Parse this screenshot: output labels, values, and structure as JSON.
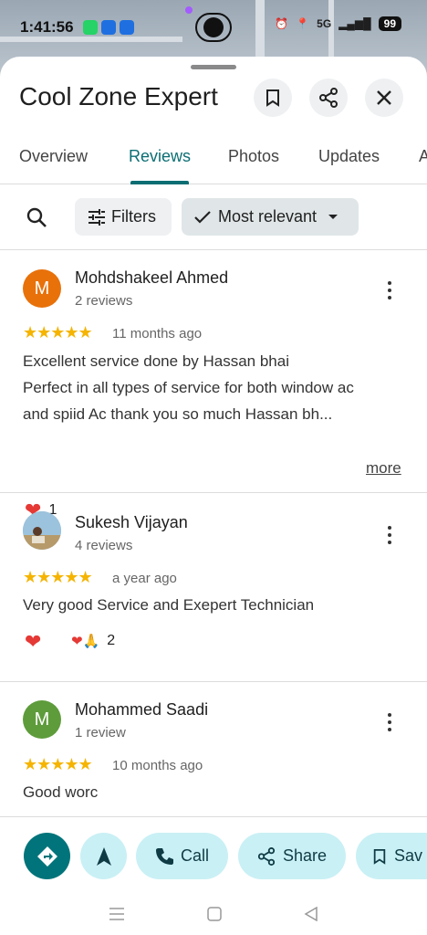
{
  "status": {
    "time": "1:41:56",
    "battery": "99",
    "network": "5G"
  },
  "place": {
    "title": "Cool Zone Expert"
  },
  "header_icons": [
    "bookmark-icon",
    "share-icon",
    "close-icon"
  ],
  "tabs": [
    {
      "label": "Overview"
    },
    {
      "label": "Reviews"
    },
    {
      "label": "Photos"
    },
    {
      "label": "Updates"
    },
    {
      "label": "A"
    }
  ],
  "active_tab": "Reviews",
  "toolbar": {
    "filters_label": "Filters",
    "sort_label": "Most relevant"
  },
  "reviews": [
    {
      "initial": "M",
      "avatar_color": "#e8710a",
      "name": "Mohdshakeel Ahmed",
      "count": "2 reviews",
      "stars": "★★★★★",
      "time": "11 months ago",
      "text_lines": [
        "Excellent service done by Hassan bhai",
        "Perfect in all types of service for both window ac",
        "and spiid Ac thank you so much Hassan bh..."
      ],
      "more_label": "more",
      "reaction_count": "1"
    },
    {
      "initial": "",
      "avatar_color": "#7aa7c7",
      "name": "Sukesh Vijayan",
      "count": "4 reviews",
      "stars": "★★★★★",
      "time": "a year ago",
      "text_lines": [
        "Very good Service and Exepert Technician"
      ],
      "reaction_count": "2"
    },
    {
      "initial": "M",
      "avatar_color": "#5e9c3b",
      "name": "Mohammed Saadi",
      "count": "1 review",
      "stars": "★★★★★",
      "time": "10 months ago",
      "text_lines": [
        "Good worc"
      ]
    }
  ],
  "actions": {
    "call_label": "Call",
    "share_label": "Share",
    "save_label": "Sav"
  },
  "colors": {
    "accent": "#0b6e73",
    "star": "#f5b400",
    "action_bg": "#c9f0f5"
  }
}
